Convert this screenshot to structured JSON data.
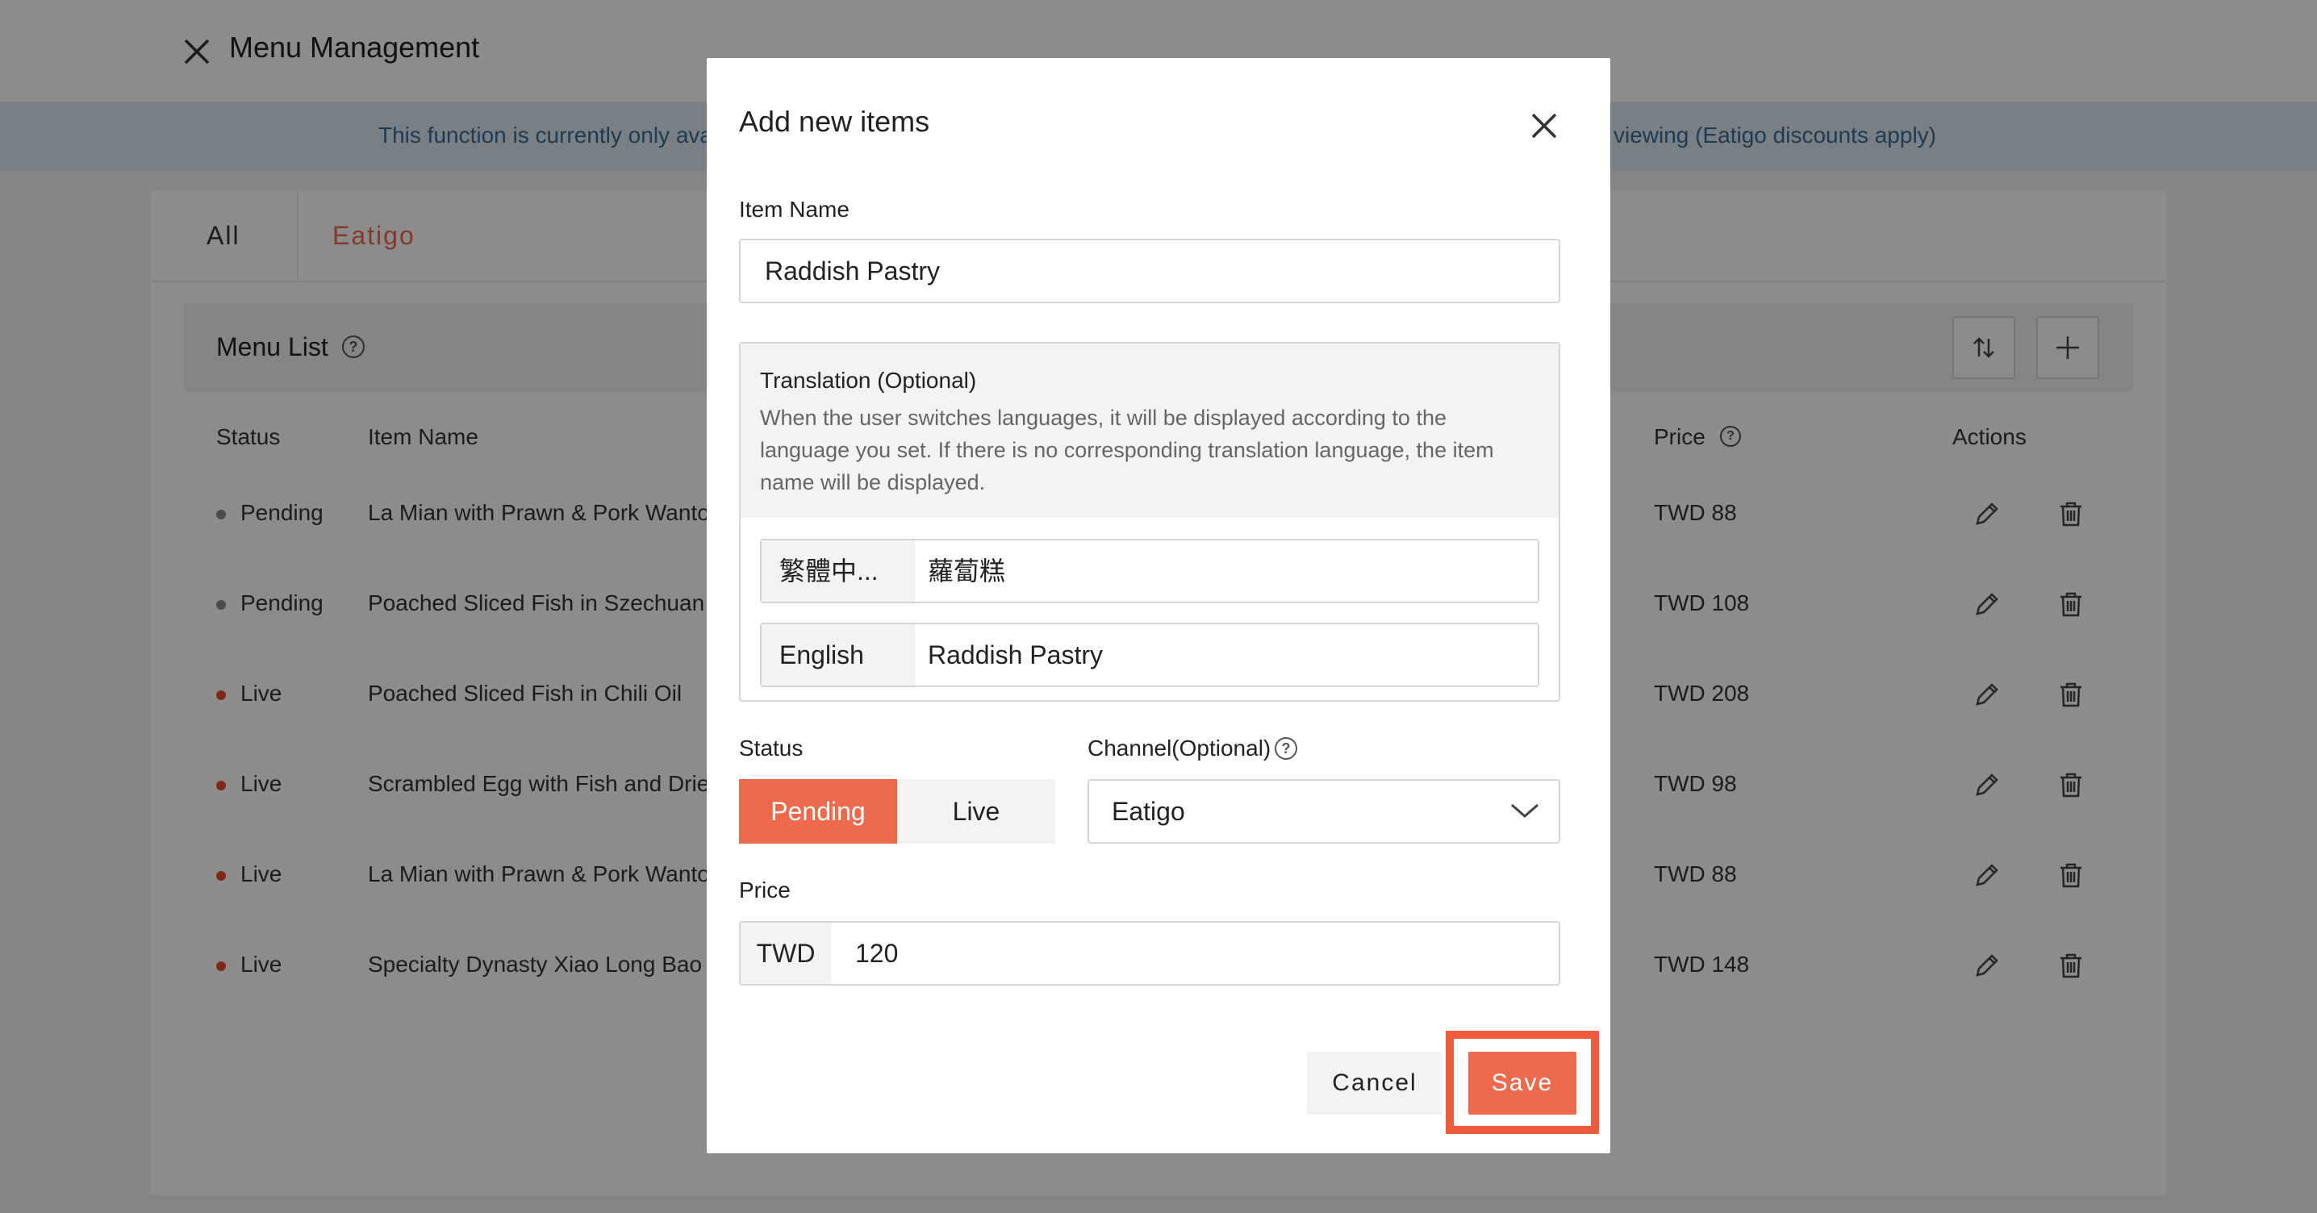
{
  "header": {
    "title": "Menu Management"
  },
  "notice": {
    "left_text": "This function is currently only ava",
    "right_text": "viewing (Eatigo discounts apply)"
  },
  "tabs": [
    {
      "label": "All"
    },
    {
      "label": "Eatigo"
    }
  ],
  "menu_list": {
    "title": "Menu List",
    "columns": {
      "status": "Status",
      "item_name": "Item Name",
      "price": "Price",
      "actions": "Actions"
    },
    "rows": [
      {
        "status": "Pending",
        "name": "La Mian with Prawn & Pork Wanto",
        "price": "TWD 88"
      },
      {
        "status": "Pending",
        "name": "Poached Sliced Fish in Szechuan (",
        "price": "TWD 108"
      },
      {
        "status": "Live",
        "name": "Poached Sliced Fish in Chili Oil",
        "price": "TWD 208"
      },
      {
        "status": "Live",
        "name": "Scrambled Egg with Fish and Drie",
        "price": "TWD 98"
      },
      {
        "status": "Live",
        "name": "La Mian with Prawn & Pork Wanto",
        "price": "TWD 88"
      },
      {
        "status": "Live",
        "name": "Specialty Dynasty Xiao Long Bao (",
        "price": "TWD 148"
      }
    ]
  },
  "modal": {
    "title": "Add new items",
    "item_name_label": "Item Name",
    "item_name_value": "Raddish Pastry",
    "translation": {
      "title": "Translation (Optional)",
      "description": "When the user switches languages, it will be displayed according to the language you set. If there is no corresponding translation language, the item name will be displayed.",
      "rows": [
        {
          "lang": "繁體中...",
          "value": "蘿蔔糕"
        },
        {
          "lang": "English",
          "value": "Raddish Pastry"
        }
      ]
    },
    "status_label": "Status",
    "status_options": {
      "pending": "Pending",
      "live": "Live"
    },
    "channel_label": "Channel(Optional)",
    "channel_value": "Eatigo",
    "price_label": "Price",
    "price_currency": "TWD",
    "price_value": "120",
    "cancel_label": "Cancel",
    "save_label": "Save"
  },
  "colors": {
    "accent": "#ee6a4d",
    "status_pending": "#8a8a8a",
    "status_live": "#e24b2d",
    "highlight": "#ee5b3c"
  }
}
